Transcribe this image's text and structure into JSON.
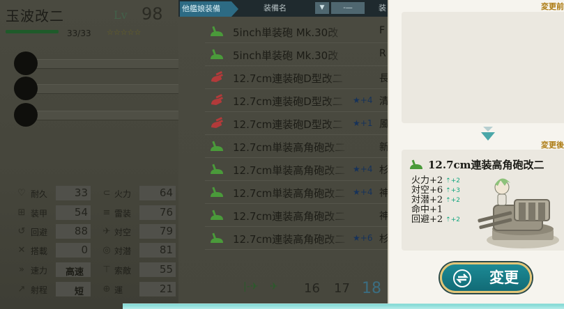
{
  "ship": {
    "name": "玉波改二",
    "lv_label": "Lv",
    "level": "98",
    "hp": "33/33",
    "stars": "☆☆☆☆☆"
  },
  "stats": [
    {
      "icon": "heart-icon",
      "glyph": "♡",
      "label": "耐久",
      "value": "33"
    },
    {
      "icon": "firepower-icon",
      "glyph": "⊂",
      "label": "火力",
      "value": "64"
    },
    {
      "icon": "armor-icon",
      "glyph": "⊞",
      "label": "装甲",
      "value": "54"
    },
    {
      "icon": "torpedo-icon",
      "glyph": "≡",
      "label": "雷装",
      "value": "76"
    },
    {
      "icon": "evasion-icon",
      "glyph": "↺",
      "label": "回避",
      "value": "88"
    },
    {
      "icon": "antiair-icon",
      "glyph": "✈",
      "label": "対空",
      "value": "79"
    },
    {
      "icon": "aircraft-icon",
      "glyph": "✕",
      "label": "搭載",
      "value": "0"
    },
    {
      "icon": "asw-icon",
      "glyph": "◎",
      "label": "対潜",
      "value": "81"
    },
    {
      "icon": "speed-icon",
      "glyph": "»",
      "label": "速力",
      "value": "高速"
    },
    {
      "icon": "los-icon",
      "glyph": "⊤",
      "label": "索敵",
      "value": "55"
    },
    {
      "icon": "range-icon",
      "glyph": "↗",
      "label": "射程",
      "value": "短"
    },
    {
      "icon": "luck-icon",
      "glyph": "⊕",
      "label": "運",
      "value": "21"
    }
  ],
  "list": {
    "tab_other": "他艦娘装備",
    "col_name": "装備名",
    "sort_glyph": "▼",
    "col_dash": "-—",
    "col_equip": "装",
    "rows": [
      {
        "icon": "green",
        "name": "5inch単装砲 Mk.30改",
        "improve": "",
        "equip": "F"
      },
      {
        "icon": "green",
        "name": "5inch単装砲 Mk.30改",
        "improve": "",
        "equip": "R"
      },
      {
        "icon": "red",
        "name": "12.7cm連装砲D型改二",
        "improve": "",
        "equip": "長"
      },
      {
        "icon": "red",
        "name": "12.7cm連装砲D型改二",
        "improve": "★+4",
        "equip": "清"
      },
      {
        "icon": "red",
        "name": "12.7cm連装砲D型改二",
        "improve": "★+1",
        "equip": "風"
      },
      {
        "icon": "green",
        "name": "12.7cm単装高角砲改二",
        "improve": "",
        "equip": "新"
      },
      {
        "icon": "green",
        "name": "12.7cm単装高角砲改二",
        "improve": "★+4",
        "equip": "杉"
      },
      {
        "icon": "green",
        "name": "12.7cm単装高角砲改二",
        "improve": "★+4",
        "equip": "神"
      },
      {
        "icon": "green",
        "name": "12.7cm連装高角砲改二",
        "improve": "",
        "equip": "神"
      },
      {
        "icon": "green",
        "name": "12.7cm連装高角砲改二",
        "improve": "★+6",
        "equip": "杉"
      }
    ],
    "pager": {
      "first": "|-✈",
      "prev": "✈",
      "p16": "16",
      "p17": "17",
      "p18": "18"
    }
  },
  "compare": {
    "before_label": "変更前",
    "after_label": "変更後",
    "after_name": "12.7cm連装高角砲改二",
    "bonuses": [
      {
        "text": "火力+2",
        "delta": "⇡+2"
      },
      {
        "text": "対空+6",
        "delta": "⇡+3"
      },
      {
        "text": "対潜+2",
        "delta": "⇡+2"
      },
      {
        "text": "命中+1",
        "delta": ""
      },
      {
        "text": "回避+2",
        "delta": "⇡+2"
      }
    ],
    "change_button": "変更"
  },
  "colors": {
    "green_icon": "#4a9a3a",
    "red_icon": "#b23a3a",
    "accent_teal": "#1c8a95",
    "gold": "#ad7c14"
  }
}
